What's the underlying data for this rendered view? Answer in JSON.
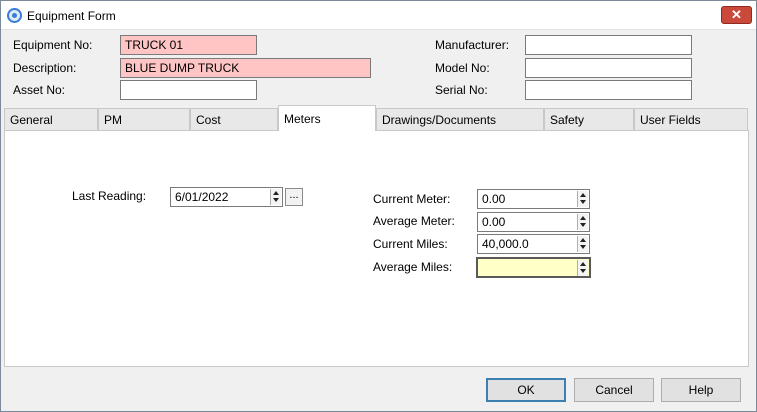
{
  "window": {
    "title": "Equipment Form",
    "close_label": "✕"
  },
  "header": {
    "equipment_no": {
      "label": "Equipment No:",
      "value": "TRUCK 01"
    },
    "description": {
      "label": "Description:",
      "value": "BLUE DUMP TRUCK"
    },
    "asset_no": {
      "label": "Asset No:",
      "value": ""
    },
    "manufacturer": {
      "label": "Manufacturer:",
      "value": ""
    },
    "model_no": {
      "label": "Model No:",
      "value": ""
    },
    "serial_no": {
      "label": "Serial No:",
      "value": ""
    }
  },
  "tabs": [
    {
      "label": "General"
    },
    {
      "label": "PM"
    },
    {
      "label": "Cost"
    },
    {
      "label": "Meters",
      "active": true
    },
    {
      "label": "Drawings/Documents"
    },
    {
      "label": "Safety"
    },
    {
      "label": "User Fields"
    }
  ],
  "meters": {
    "last_reading": {
      "label": "Last Reading:",
      "value": "6/01/2022",
      "ellipsis": "..."
    },
    "current_meter": {
      "label": "Current Meter:",
      "value": "0.00"
    },
    "average_meter": {
      "label": "Average Meter:",
      "value": "0.00"
    },
    "current_miles": {
      "label": "Current Miles:",
      "value": "40,000.0"
    },
    "average_miles": {
      "label": "Average Miles:",
      "value": ""
    }
  },
  "buttons": {
    "ok": "OK",
    "cancel": "Cancel",
    "help": "Help"
  },
  "colors": {
    "required_field": "#ffc4c4",
    "focused_field": "#ffffc8",
    "close_button": "#c94a3b"
  }
}
